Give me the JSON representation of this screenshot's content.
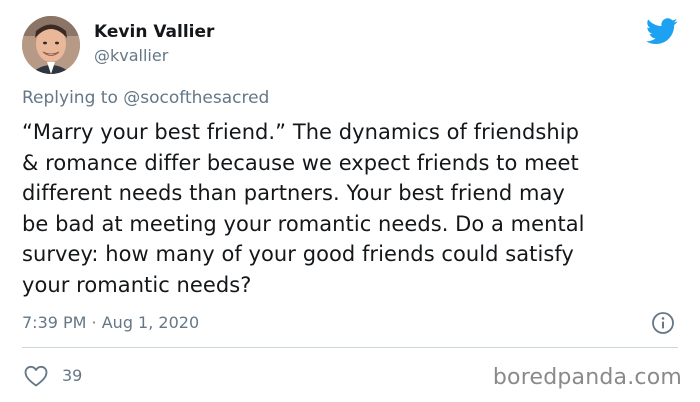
{
  "author": {
    "display_name": "Kevin Vallier",
    "handle": "@kvallier",
    "avatar_icon": "user-avatar"
  },
  "brand": {
    "icon": "twitter-bird-icon",
    "color": "#1da1f2"
  },
  "reply": {
    "prefix": "Replying to",
    "mention": "@socofthesacred"
  },
  "tweet": {
    "lines": [
      "“Marry your best friend.” The dynamics of friendship",
      "& romance differ because we expect friends to meet",
      "different needs than partners. Your best friend may",
      "be bad at meeting your romantic needs. Do a mental",
      "survey: how many of your good friends could satisfy",
      "your romantic needs?"
    ],
    "timestamp": "7:39 PM · Aug 1, 2020"
  },
  "engagement": {
    "likes": "39",
    "like_icon": "heart-outline-icon",
    "info_icon": "info-icon"
  },
  "watermark": "boredpanda.com"
}
